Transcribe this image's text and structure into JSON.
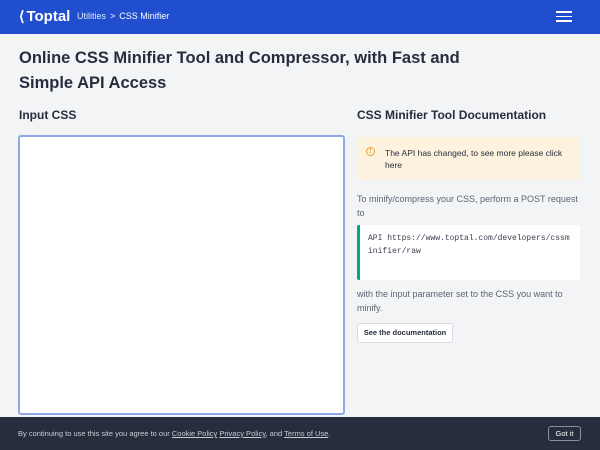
{
  "topbar": {
    "brand": "Toptal",
    "breadcrumbs": [
      "Utilities",
      "CSS Minifier"
    ],
    "separator": ">"
  },
  "page": {
    "title": "Online CSS Minifier Tool and Compressor, with Fast and Simple API Access"
  },
  "input": {
    "heading": "Input CSS",
    "value": ""
  },
  "docs": {
    "heading": "CSS Minifier Tool Documentation",
    "alert": "The API has changed, to see more please click here",
    "intro": "To minify/compress your CSS, perform a POST request to",
    "code": "API https://www.toptal.com/developers/cssminifier/raw",
    "outro": "with the input parameter set to the CSS you want to minify.",
    "button": "See the documentation"
  },
  "cookie": {
    "prefix": "By continuing to use this site you agree to our",
    "cookie_policy": "Cookie Policy",
    "privacy_policy": "Privacy Policy",
    "and": ", and",
    "terms": "Terms of Use",
    "suffix": ".",
    "button": "Got it"
  },
  "colors": {
    "topbar": "#204ecf",
    "code_accent": "#00a982",
    "alert_bg": "#fdf2de",
    "cookie_bg": "#262d3d"
  }
}
